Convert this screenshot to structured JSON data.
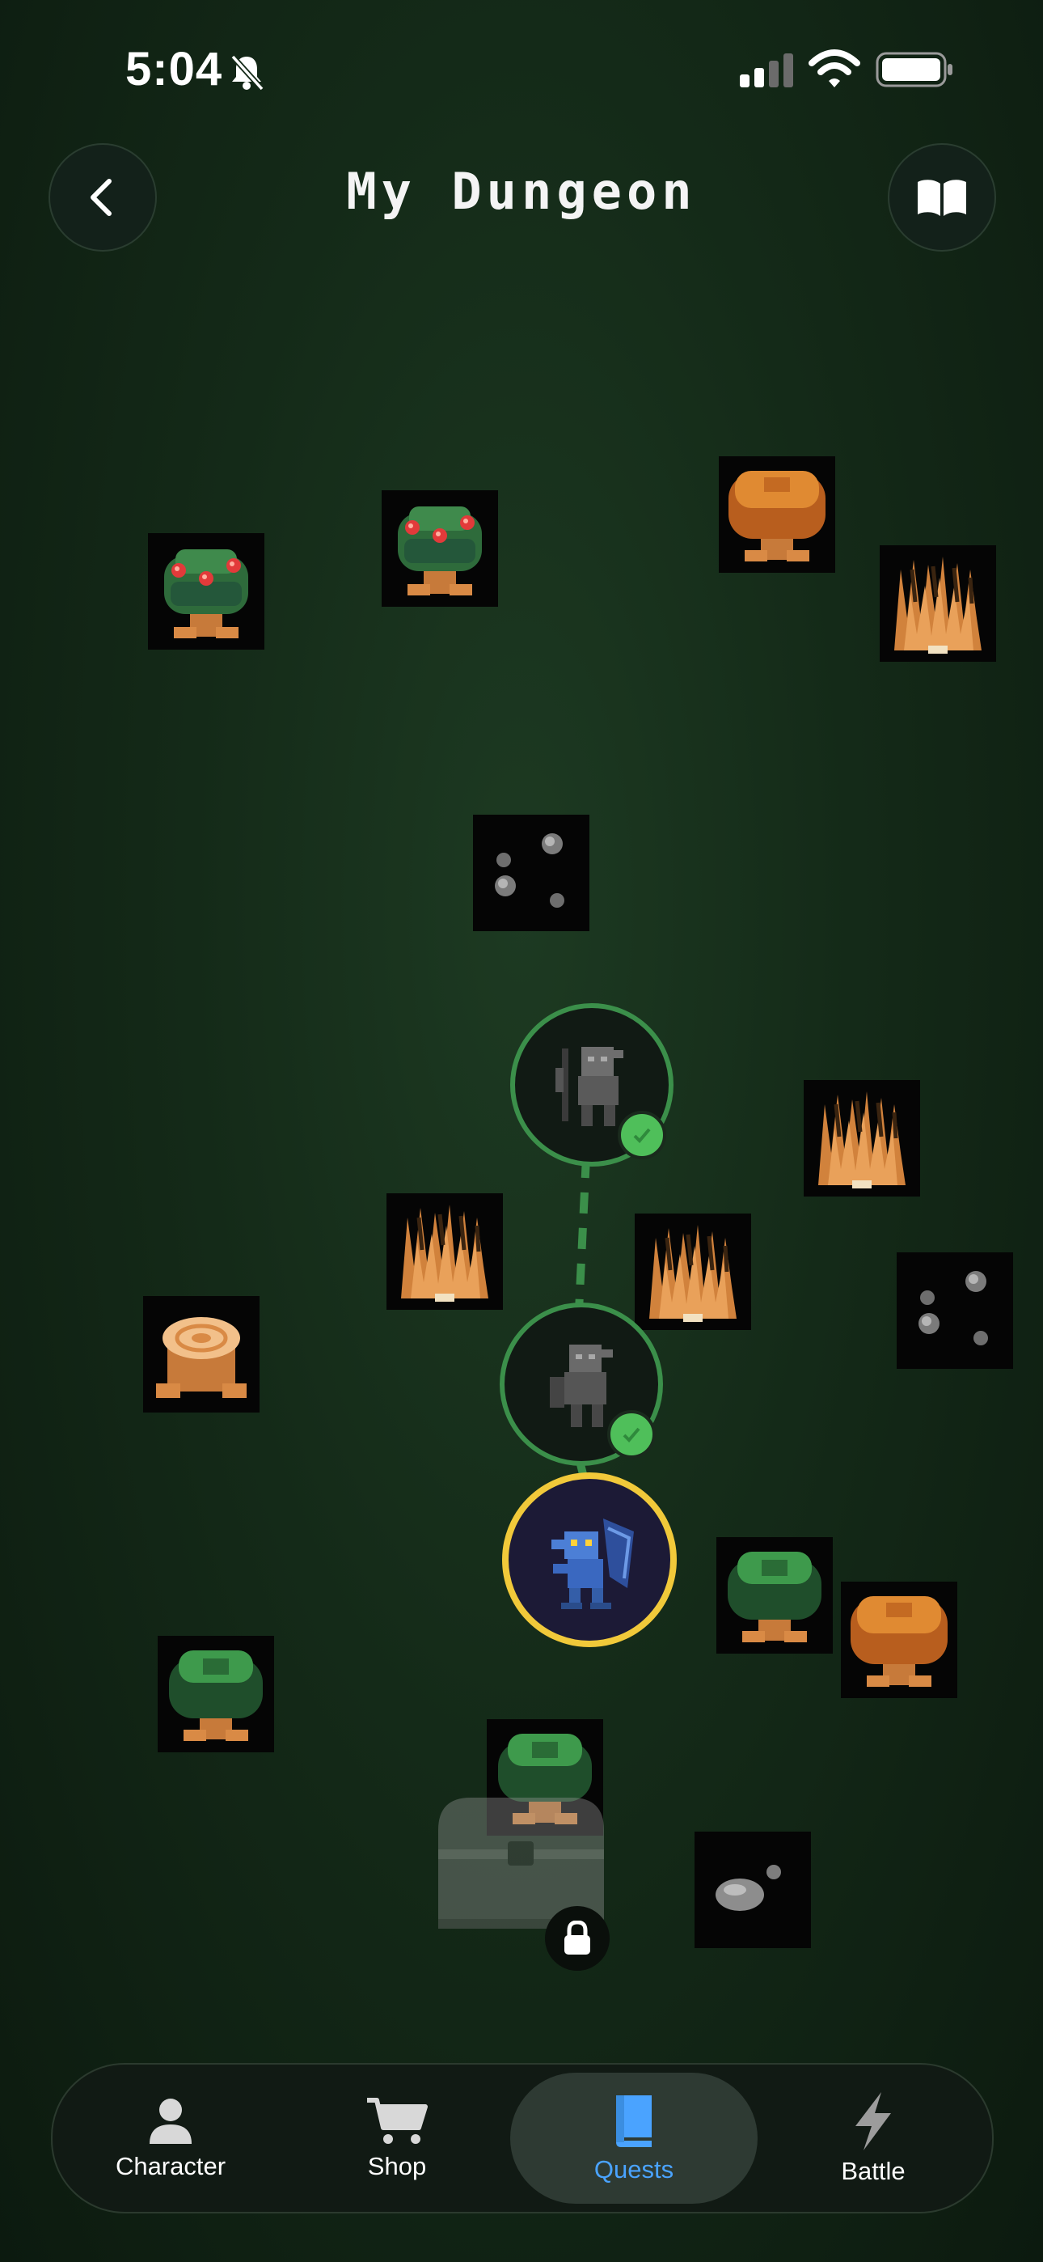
{
  "status": {
    "time": "5:04"
  },
  "header": {
    "title": "My Dungeon"
  },
  "tabs": [
    {
      "label": "Character",
      "icon": "person-icon",
      "active": false
    },
    {
      "label": "Shop",
      "icon": "cart-icon",
      "active": false
    },
    {
      "label": "Quests",
      "icon": "book-icon",
      "active": true
    },
    {
      "label": "Battle",
      "icon": "bolt-icon",
      "active": false
    }
  ],
  "map": {
    "completed_nodes": 2,
    "current_node": "blue-dragon",
    "locked_reward": "treasure-chest"
  },
  "colors": {
    "path": "#3b8f4a",
    "current_ring": "#f1c93a",
    "active_tab": "#4aa3ff",
    "check": "#4fbf5a"
  }
}
